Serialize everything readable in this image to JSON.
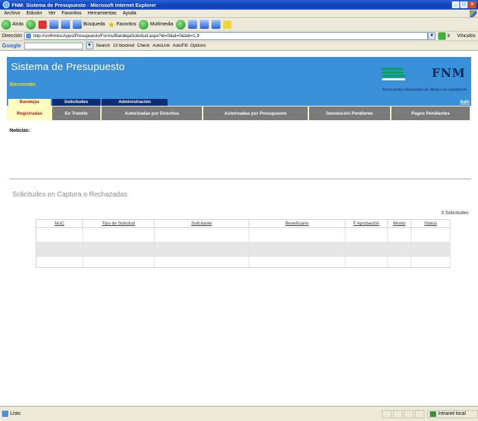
{
  "window": {
    "title": "FNM: Sistema de Presupuesto - Microsoft Internet Explorer",
    "controls": [
      "_",
      "□",
      "×"
    ]
  },
  "menu": [
    "Archivo",
    "Edición",
    "Ver",
    "Favoritos",
    "Herramientas",
    "Ayuda"
  ],
  "toolbar": {
    "back": "Atrás",
    "search": "Búsqueda",
    "favorites": "Favoritos",
    "multimedia": "Multimedia"
  },
  "address": {
    "label": "Dirección",
    "url": "http://srvfnmiis/Apps/Presupuesto/Forms/BandejaSolicitud.aspx?id=0&id=0&tab=1,9",
    "go": "Ir",
    "links": "Vínculos"
  },
  "googlebar": {
    "brand": "Google",
    "search": "Search",
    "blocked": "13 blocked",
    "check": "Check",
    "autolink": "AutoLink",
    "autofill": "AutoFill",
    "options": "Options"
  },
  "banner": {
    "title": "Sistema de Presupuesto",
    "welcome": "Bienvenido",
    "logo": "FNM",
    "logo_subtitle": "Ferrocarriles Nacionales de México en Liquidación",
    "stripe_colors": [
      "#00a651",
      "#00a651",
      "#00a651",
      "#ffffff"
    ]
  },
  "tabs_primary": [
    "Bandejas",
    "Solicitudes",
    "Administración"
  ],
  "tabs_secondary": [
    "Registradas",
    "En Trámite",
    "Autorizadas por Directiva",
    "Autorizadas por Presupuesto",
    "Devolución Pendiente",
    "Pagos Pendientes"
  ],
  "salir": "Salir",
  "noticias_label": "Noticias:",
  "section_title": "Solicitudes en Captura o Rechazadas",
  "count_text": "3 Solicitudes",
  "table": {
    "columns": [
      "NUC",
      "Tipo de Solicitud",
      "Solicitante",
      "Beneficiario",
      "F.Aprobación",
      "Monto",
      "Status"
    ],
    "rows": [
      [
        "",
        "",
        "",
        "",
        "",
        "",
        ""
      ],
      [
        "",
        "",
        "",
        "",
        "",
        "",
        ""
      ],
      [
        "",
        "",
        "",
        "",
        "",
        "",
        ""
      ]
    ]
  },
  "status": {
    "text": "Listo",
    "zone": "Intranet local"
  },
  "colors": {
    "banner": "#3a8fd9",
    "welcome": "#ffe000",
    "active_tab_bg": "#fffcc0",
    "inactive_tab_bg": "#7a7a7a",
    "primary_tab_bg": "#0d2d74"
  }
}
